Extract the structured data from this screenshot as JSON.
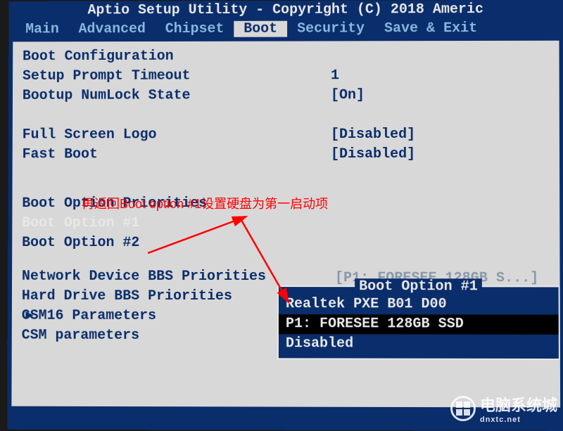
{
  "title": "Aptio Setup Utility - Copyright (C) 2018 Americ",
  "menu": {
    "items": [
      "Main",
      "Advanced",
      "Chipset",
      "Boot",
      "Security",
      "Save & Exit"
    ],
    "active_index": 3
  },
  "sections": {
    "boot_config": "Boot Configuration",
    "priorities": "Boot Option Priorities"
  },
  "settings": [
    {
      "label": "Setup Prompt Timeout",
      "value": "1"
    },
    {
      "label": "Bootup NumLock State",
      "value": "[On]"
    }
  ],
  "settings2": [
    {
      "label": "Full Screen Logo",
      "value": "[Disabled]"
    },
    {
      "label": "Fast Boot",
      "value": "[Disabled]"
    }
  ],
  "boot_options": [
    {
      "label": "Boot Option #1",
      "value": "[P1: FORESEE 128GB S...]",
      "selected": true
    },
    {
      "label": "Boot Option #2",
      "value": "",
      "selected": false
    }
  ],
  "links": [
    "Network Device BBS Priorities",
    "Hard Drive BBS Priorities",
    "CSM16 Parameters",
    "CSM parameters"
  ],
  "popup": {
    "title": "Boot Option #1",
    "items": [
      "Realtek PXE B01 D00",
      "P1: FORESEE 128GB SSD",
      "Disabled"
    ],
    "highlight_index": 1
  },
  "annotation": "再返回Boot option #1设置硬盘为第一启动项",
  "watermark": {
    "text": "电脑系统城",
    "sub": "dnxtc.net"
  }
}
